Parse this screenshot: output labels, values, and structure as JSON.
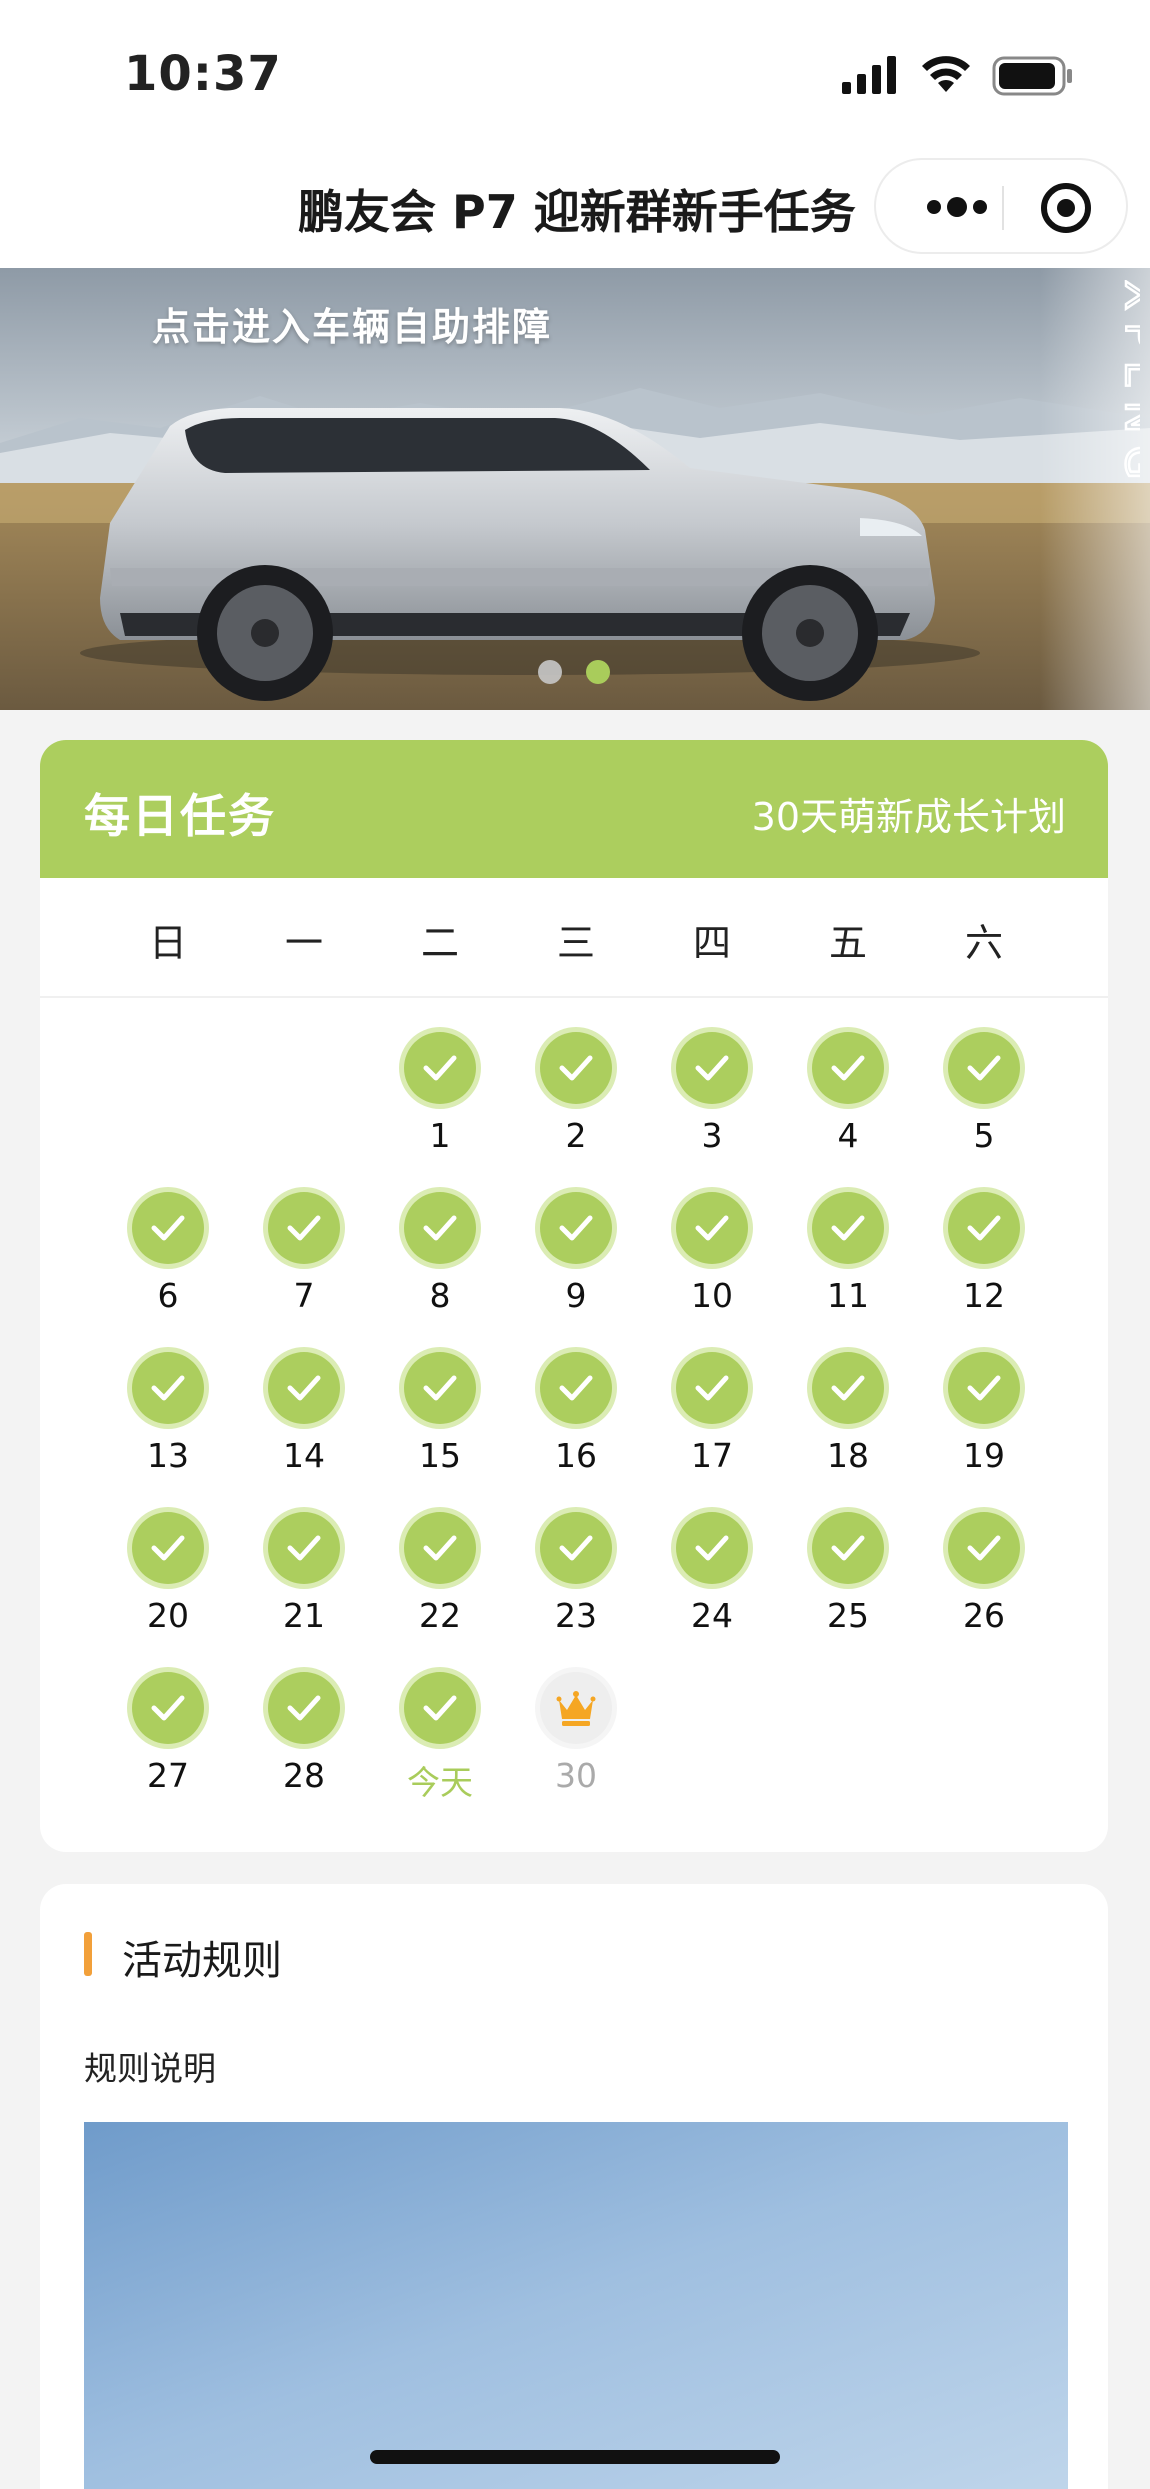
{
  "status_bar": {
    "time": "10:37",
    "icons": [
      "cellular-signal-icon",
      "wifi-icon",
      "battery-icon"
    ]
  },
  "nav": {
    "title": "鹏友会 P7 迎新群新手任务",
    "more_icon": "more-dots-icon",
    "close_icon": "target-circle-icon"
  },
  "banner": {
    "text": "点击进入车辆自助排障",
    "brand_text": "XPENG",
    "active_slide": 2,
    "slide_count": 2
  },
  "task": {
    "title": "每日任务",
    "subtitle": "30天萌新成长计划",
    "weekdays": [
      "日",
      "一",
      "二",
      "三",
      "四",
      "五",
      "六"
    ],
    "days": [
      {
        "label": "1",
        "state": "done"
      },
      {
        "label": "2",
        "state": "done"
      },
      {
        "label": "3",
        "state": "done"
      },
      {
        "label": "4",
        "state": "done"
      },
      {
        "label": "5",
        "state": "done"
      },
      {
        "label": "6",
        "state": "done"
      },
      {
        "label": "7",
        "state": "done"
      },
      {
        "label": "8",
        "state": "done"
      },
      {
        "label": "9",
        "state": "done"
      },
      {
        "label": "10",
        "state": "done"
      },
      {
        "label": "11",
        "state": "done"
      },
      {
        "label": "12",
        "state": "done"
      },
      {
        "label": "13",
        "state": "done"
      },
      {
        "label": "14",
        "state": "done"
      },
      {
        "label": "15",
        "state": "done"
      },
      {
        "label": "16",
        "state": "done"
      },
      {
        "label": "17",
        "state": "done"
      },
      {
        "label": "18",
        "state": "done"
      },
      {
        "label": "19",
        "state": "done"
      },
      {
        "label": "20",
        "state": "done"
      },
      {
        "label": "21",
        "state": "done"
      },
      {
        "label": "22",
        "state": "done"
      },
      {
        "label": "23",
        "state": "done"
      },
      {
        "label": "24",
        "state": "done"
      },
      {
        "label": "25",
        "state": "done"
      },
      {
        "label": "26",
        "state": "done"
      },
      {
        "label": "27",
        "state": "done"
      },
      {
        "label": "28",
        "state": "done"
      },
      {
        "label": "今天",
        "state": "today"
      },
      {
        "label": "30",
        "state": "reward"
      }
    ]
  },
  "rules": {
    "title": "活动规则",
    "subtitle": "规则说明"
  },
  "colors": {
    "accent_green": "#acce5e",
    "accent_orange": "#f2a03a",
    "crown_orange": "#f5a623"
  }
}
